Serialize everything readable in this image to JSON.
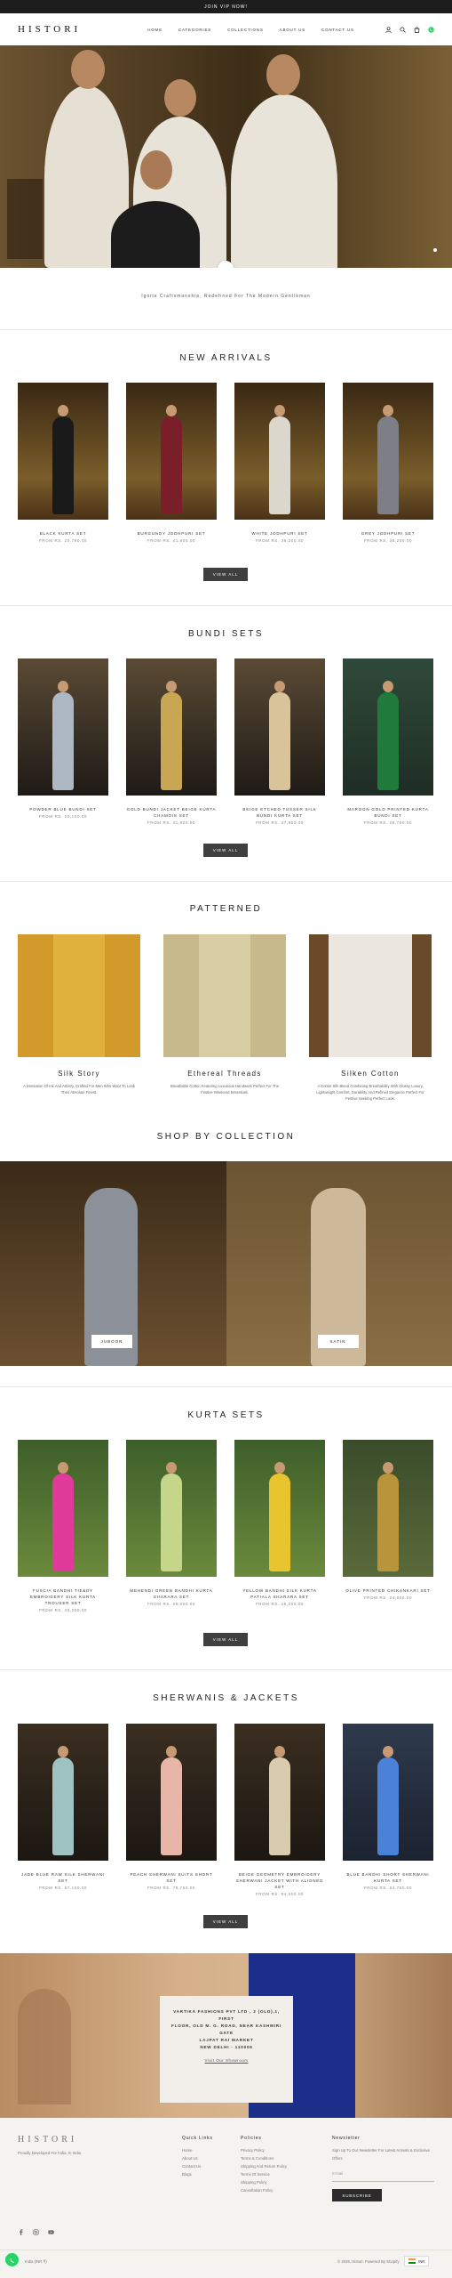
{
  "announcement": "JOIN VIP NOW!",
  "header": {
    "logo": "HISTORI",
    "nav": [
      "HOME",
      "CATEGORIES",
      "COLLECTIONS",
      "ABOUT US",
      "CONTACT US"
    ]
  },
  "hero": {
    "tagline": "Ignite Craftsmanship, Redefined For The Modern Gentleman"
  },
  "new_arrivals": {
    "title": "NEW ARRIVALS",
    "view_all": "VIEW ALL",
    "items": [
      {
        "name": "BLACK KURTA SET",
        "price": "FROM RS. 20,790.00"
      },
      {
        "name": "BURGUNDY JODHPURI SET",
        "price": "FROM RS. 41,900.00"
      },
      {
        "name": "WHITE JODHPURI SET",
        "price": "FROM RS. 38,200.00"
      },
      {
        "name": "GREY JODHPURI SET",
        "price": "FROM RS. 36,200.00"
      }
    ]
  },
  "bundi_sets": {
    "title": "BUNDI SETS",
    "view_all": "VIEW ALL",
    "items": [
      {
        "name": "POWDER BLUE BUNDI SET",
        "price": "FROM RS. 20,100.00"
      },
      {
        "name": "GOLD BUNDI JACKET BEIGE KURTA CHAMOIS SET",
        "price": "FROM RS. 31,800.00"
      },
      {
        "name": "BEIGE ETCHED TUSSER SILK BUNDI KURTA SET",
        "price": "FROM RS. 27,850.00"
      },
      {
        "name": "MAROON GOLD PRINTED KURTA BUNDI SET",
        "price": "FROM RS. 28,750.00"
      }
    ]
  },
  "patterned": {
    "title": "PATTERNED",
    "items": [
      {
        "title": "Silk Story",
        "desc": "A Sensation Of Ink And Artistry, Crafted For Men Who Want To Look Their Absolute Finest."
      },
      {
        "title": "Ethereal Threads",
        "desc": "Breathable Cotton Featuring Luxurious Handwork Perfect For The Festive Weekend Essentials."
      },
      {
        "title": "Silken Cotton",
        "desc": "A Cotton Silk Blend Combining Breathability With Glossy Luxury, Lightweight Comfort, Durability And Refined Elegance Perfect For Festive Seeking Perfect Look."
      }
    ]
  },
  "shop_by_collection": {
    "title": "SHOP BY COLLECTION",
    "items": [
      "JUBOON",
      "SATIN"
    ]
  },
  "kurta_sets": {
    "title": "KURTA SETS",
    "view_all": "VIEW ALL",
    "items": [
      {
        "name": "FUSCIA BANDHI TIE&DY EMBROIDERY SILK KURTA TROUSER SET",
        "price": "FROM RS. 26,250.00"
      },
      {
        "name": "MEHENDI GREEN BANDHI KURTA SHARARA SET",
        "price": "FROM RS. 28,000.00"
      },
      {
        "name": "YELLOW BANDHI SILK KURTA PATIALA SHARARA SET",
        "price": "FROM RS. 28,000.00"
      },
      {
        "name": "OLIVE PRINTED CHIKANKARI SET",
        "price": "FROM RS. 24,600.00"
      }
    ]
  },
  "sherwanis": {
    "title": "SHERWANIS & JACKETS",
    "view_all": "VIEW ALL",
    "items": [
      {
        "name": "JADE BLUE RAW SILK SHERWANI SET",
        "price": "FROM RS. 87,150.00"
      },
      {
        "name": "PEACH SHERWANI SUITS SHORT SET",
        "price": "FROM RS. 78,750.00"
      },
      {
        "name": "BEIGE GEOMETRY EMBROIDERY SHERWANI JACKET WITH ALIGNED SET",
        "price": "FROM RS. 94,500.00"
      },
      {
        "name": "BLUE BANDHI SHORT SHERWANI KURTA SET",
        "price": "FROM RS. 84,750.00"
      }
    ]
  },
  "promo": {
    "address_lines": [
      "VARTIKA FASHIONS PVT LTD , 2 (OLD),1, FIRST",
      "FLOOR, OLD M. G. ROAD, NEAR KASHMIRI",
      "GATE",
      "LAJPAT RAI MARKET",
      "NEW DELHI - 110006"
    ],
    "link": "Visit Our Showroom"
  },
  "footer": {
    "logo": "HISTORI",
    "tagline": "Proudly Developed For India, In India",
    "cols": [
      {
        "title": "Quick Links",
        "items": [
          "Home",
          "About Us",
          "Contact Us",
          "Blogs"
        ]
      },
      {
        "title": "Policies",
        "items": [
          "Privacy Policy",
          "Terms & Conditions",
          "Shipping And Return Policy",
          "Terms Of Service",
          "Shipping Policy",
          "Cancellation Policy"
        ]
      },
      {
        "title": "Newsletter",
        "items": [
          "Sign Up To Our Newsletter For Latest Arrivals & Exclusive Offers"
        ]
      }
    ],
    "email_placeholder": "E-mail",
    "subscribe": "SUBSCRIBE",
    "copyright": "© 2025, Histori. Powered By Shopify",
    "currency": "INR",
    "country_left": "India (INR ₹)"
  }
}
